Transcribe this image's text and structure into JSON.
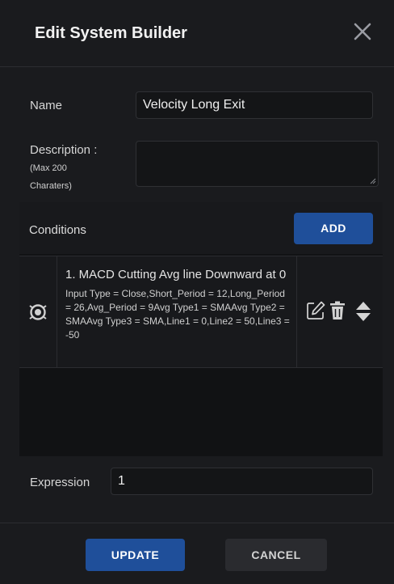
{
  "header": {
    "title": "Edit System Builder"
  },
  "form": {
    "name_label": "Name",
    "name_value": "Velocity Long Exit",
    "description_label": "Description :",
    "description_hint_line1": "(Max 200",
    "description_hint_line2": "Charaters)",
    "description_value": "",
    "expression_label": "Expression",
    "expression_value": "1"
  },
  "conditions": {
    "title": "Conditions",
    "add_label": "ADD",
    "items": [
      {
        "title": "1. MACD Cutting Avg line Downward at 0",
        "detail": "Input Type = Close,Short_Period = 12,Long_Period = 26,Avg_Period = 9Avg Type1 = SMAAvg Type2 = SMAAvg Type3 = SMA,Line1 = 0,Line2 = 50,Line3 = -50"
      }
    ]
  },
  "footer": {
    "update_label": "UPDATE",
    "cancel_label": "CANCEL"
  },
  "icons": {
    "close": "close-icon",
    "condition": "condition-type-icon",
    "edit": "edit-icon",
    "delete": "trash-icon",
    "reorder": "reorder-arrows-icon"
  },
  "colors": {
    "accent": "#1f4f9a",
    "background": "#1a1b1e"
  }
}
